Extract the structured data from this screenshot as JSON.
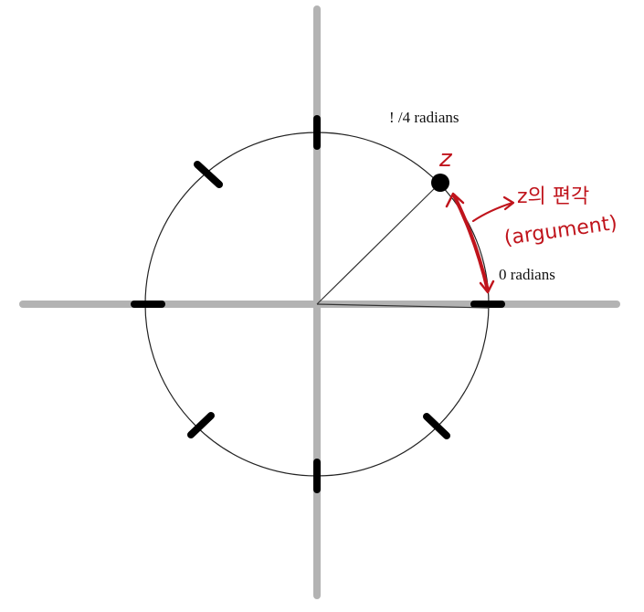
{
  "labels": {
    "angle_pi_over_4": "! /4 radians",
    "angle_zero": "0 radians",
    "point_name": "z",
    "arg_korean": "z의 편각",
    "arg_english": "(argument)"
  },
  "colors": {
    "axis": "#b3b3b3",
    "circle": "#222222",
    "tick": "#000000",
    "annotation": "#c0141c",
    "background": "#ffffff"
  }
}
